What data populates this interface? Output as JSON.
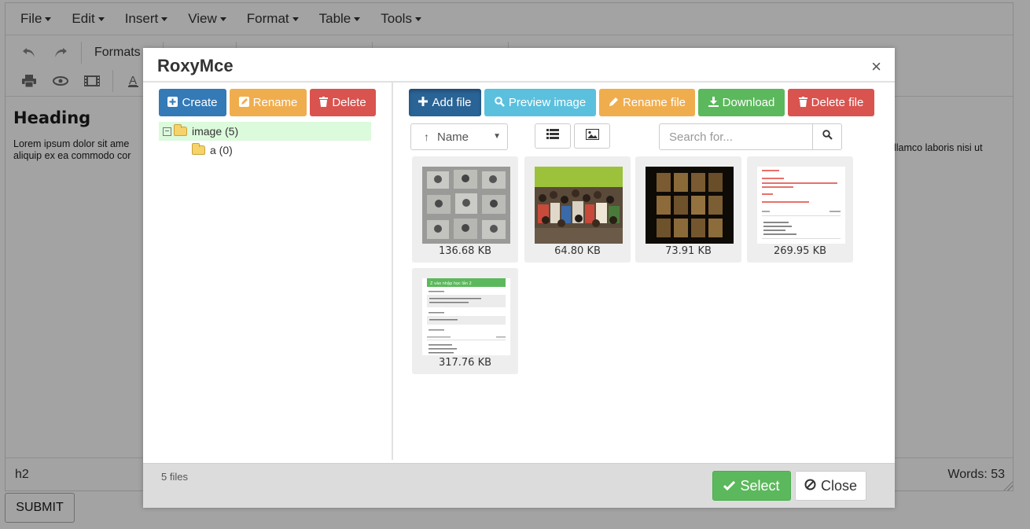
{
  "editor": {
    "menu": [
      "File",
      "Edit",
      "Insert",
      "View",
      "Format",
      "Table",
      "Tools"
    ],
    "formats_label": "Formats",
    "heading": "Heading",
    "lorem_left_line1": "Lorem ipsum dolor sit ame",
    "lorem_left_line2": "aliquip ex ea commodo cor",
    "lorem_right": "llamco laboris nisi ut",
    "status_path": "h2",
    "word_count": "Words: 53",
    "submit_label": "SUBMIT"
  },
  "modal": {
    "title": "RoxyMce",
    "close_x": "×",
    "dir_buttons": {
      "create": "Create",
      "rename": "Rename",
      "delete": "Delete"
    },
    "tree": [
      {
        "label": "image (5)",
        "toggle": "−"
      },
      {
        "label": "a (0)"
      }
    ],
    "file_buttons": {
      "add": "Add file",
      "preview": "Preview image",
      "rename": "Rename file",
      "download": "Download",
      "delete": "Delete file"
    },
    "sort": {
      "label": "Name",
      "direction": "↑"
    },
    "search_placeholder": "Search for...",
    "files": [
      {
        "size": "136.68 KB"
      },
      {
        "size": "64.80 KB"
      },
      {
        "size": "73.91 KB"
      },
      {
        "size": "269.95 KB"
      },
      {
        "size": "317.76 KB"
      }
    ],
    "thumb_text": {
      "receipt_green_header": "Z vào nhập học lần 2"
    },
    "file_count": "5 files",
    "select_label": "Select",
    "close_label": "Close"
  },
  "colors": {
    "primary": "#337ab7",
    "warning": "#f0ad4e",
    "danger": "#d9534f",
    "info": "#5bc0de",
    "success": "#5cb85c"
  }
}
